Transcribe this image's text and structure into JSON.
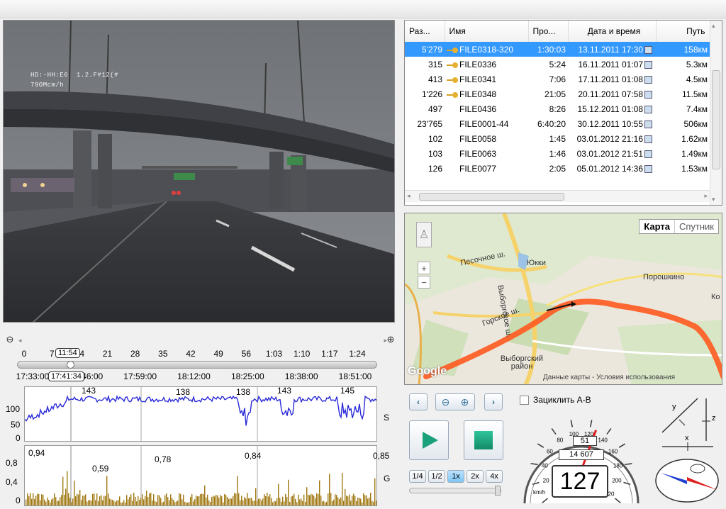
{
  "video": {
    "osd_line1": "HD:-HH:E6  1.2.F#12(#",
    "osd_line2": "79OMcm/h"
  },
  "file_table": {
    "columns": [
      "Раз...",
      "Имя",
      "Про...",
      "Дата и время",
      "Путь"
    ],
    "rows": [
      {
        "size": "5'279",
        "locked": true,
        "name": "FILE0318-320",
        "duration": "1:30:03",
        "datetime": "13.11.2011 17:30",
        "distance": "158км"
      },
      {
        "size": "315",
        "locked": true,
        "name": "FILE0336",
        "duration": "5:24",
        "datetime": "16.11.2011 01:07",
        "distance": "5.3км"
      },
      {
        "size": "413",
        "locked": true,
        "name": "FILE0341",
        "duration": "7:06",
        "datetime": "17.11.2011 01:08",
        "distance": "4.5км"
      },
      {
        "size": "1'226",
        "locked": true,
        "name": "FILE0348",
        "duration": "21:05",
        "datetime": "20.11.2011 07:58",
        "distance": "11.5км"
      },
      {
        "size": "497",
        "locked": false,
        "name": "FILE0436",
        "duration": "8:26",
        "datetime": "15.12.2011 01:08",
        "distance": "7.4км"
      },
      {
        "size": "23'765",
        "locked": false,
        "name": "FILE0001-44",
        "duration": "6:40:20",
        "datetime": "30.12.2011 10:55",
        "distance": "506км"
      },
      {
        "size": "102",
        "locked": false,
        "name": "FILE0058",
        "duration": "1:45",
        "datetime": "03.01.2012 21:16",
        "distance": "1.62км"
      },
      {
        "size": "103",
        "locked": false,
        "name": "FILE0063",
        "duration": "1:46",
        "datetime": "03.01.2012 21:51",
        "distance": "1.49км"
      },
      {
        "size": "126",
        "locked": false,
        "name": "FILE0077",
        "duration": "2:05",
        "datetime": "05.01.2012 14:36",
        "distance": "1.53км"
      }
    ]
  },
  "map": {
    "btn_map": "Карта",
    "btn_satellite": "Спутник",
    "labels": [
      "Песочное ш.",
      "Юкки",
      "Порошкино",
      "Выборгское ш.",
      "Горское ш.",
      "Выборгский район",
      "Ко"
    ],
    "footer_data": "Данные карты",
    "footer_terms": "Условия использования",
    "logo": "Google",
    "zoom_in": "+",
    "zoom_out": "−"
  },
  "timeline": {
    "zoom_out": "⊖",
    "zoom_in": "⊕",
    "top_ticks": [
      "0",
      "7",
      "14",
      "21",
      "28",
      "35",
      "42",
      "49",
      "56",
      "1:03",
      "1:10",
      "1:17",
      "1:24"
    ],
    "top_position": "11:54",
    "bottom_ticks": [
      "17:33:00",
      "17:46:00",
      "17:59:00",
      "18:12:00",
      "18:25:00",
      "18:38:00",
      "18:51:00"
    ],
    "bottom_position": "17:41:34"
  },
  "speed_graph": {
    "axis_labels": [
      "100",
      "50",
      "0"
    ],
    "unit": "S",
    "peaks": [
      "143",
      "138",
      "138",
      "143",
      "145"
    ]
  },
  "g_graph": {
    "axis_labels": [
      "0,8",
      "0,4",
      "0"
    ],
    "unit": "G",
    "peaks": [
      "0,94",
      "0,59",
      "0,78",
      "0,84",
      "0,85"
    ]
  },
  "controls": {
    "prev": "‹",
    "next": "›",
    "loop_label": "Зациклить A-B",
    "speeds": [
      "1/4",
      "1/2",
      "1x",
      "2x",
      "4x"
    ],
    "active_speed": "1x"
  },
  "speedometer": {
    "scale": [
      "0",
      "20",
      "40",
      "60",
      "80",
      "100",
      "120",
      "140",
      "160",
      "180",
      "200",
      "220"
    ],
    "trip": "51",
    "odometer": "14 607",
    "speed": "127",
    "unit": "km/h",
    "needle_value": 127
  },
  "gsensor": {
    "y": "y",
    "z": "z",
    "x": "x"
  },
  "colors": {
    "speed_line": "#2a2ad8",
    "g_bars": "#a07810",
    "route": "#ff5a1f",
    "selection": "#3399ff"
  }
}
